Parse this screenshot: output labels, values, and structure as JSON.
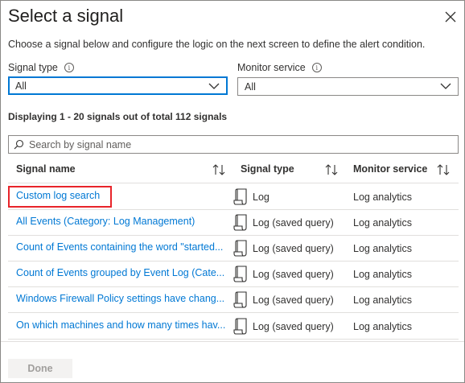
{
  "title": "Select a signal",
  "description": "Choose a signal below and configure the logic on the next screen to define the alert condition.",
  "filters": {
    "signal_type_label": "Signal type",
    "signal_type_value": "All",
    "monitor_service_label": "Monitor service",
    "monitor_service_value": "All"
  },
  "count_text": "Displaying 1 - 20 signals out of total 112 signals",
  "search": {
    "placeholder": "Search by signal name"
  },
  "table": {
    "headers": [
      "Signal name",
      "Signal type",
      "Monitor service"
    ],
    "rows": [
      {
        "name": "Custom log search",
        "type": "Log",
        "monitor": "Log analytics"
      },
      {
        "name": "All Events (Category: Log Management)",
        "type": "Log (saved query)",
        "monitor": "Log analytics"
      },
      {
        "name": "Count of Events containing the word \"started...",
        "type": "Log (saved query)",
        "monitor": "Log analytics"
      },
      {
        "name": "Count of Events grouped by Event Log (Cate...",
        "type": "Log (saved query)",
        "monitor": "Log analytics"
      },
      {
        "name": "Windows Firewall Policy settings have chang...",
        "type": "Log (saved query)",
        "monitor": "Log analytics"
      },
      {
        "name": "On which machines and how many times hav...",
        "type": "Log (saved query)",
        "monitor": "Log analytics"
      }
    ]
  },
  "footer": {
    "done_label": "Done"
  },
  "colors": {
    "link": "#0078d4",
    "focus": "#0078d4",
    "highlight": "#e8242a"
  },
  "icons": {
    "close": "close-icon",
    "info": "info-icon",
    "chevron": "chevron-down-icon",
    "search": "search-icon",
    "sort": "sort-icon",
    "log": "log-scroll-icon"
  }
}
